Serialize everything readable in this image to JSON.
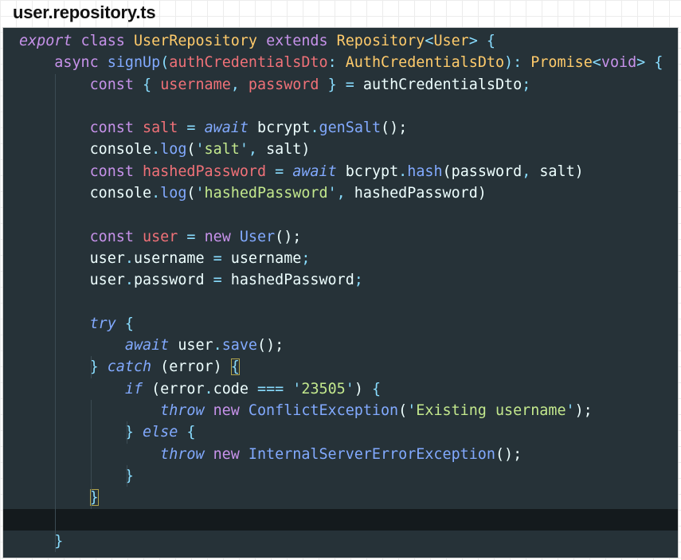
{
  "file_title": "user.repository.ts",
  "colors": {
    "background": "#263238",
    "keyword": "#c792ea",
    "type": "#ffcb6b",
    "function": "#82aaff",
    "parameter": "#f07178",
    "punctuation": "#89ddff",
    "string": "#c3e88d",
    "text": "#eeffff"
  },
  "code": {
    "lines": [
      [
        {
          "t": "export",
          "c": "kwi"
        },
        {
          "t": " ",
          "c": "txt"
        },
        {
          "t": "class",
          "c": "kw"
        },
        {
          "t": " ",
          "c": "txt"
        },
        {
          "t": "UserRepository",
          "c": "cls"
        },
        {
          "t": " ",
          "c": "txt"
        },
        {
          "t": "extends",
          "c": "kw"
        },
        {
          "t": " ",
          "c": "txt"
        },
        {
          "t": "Repository",
          "c": "cls"
        },
        {
          "t": "<",
          "c": "pun"
        },
        {
          "t": "User",
          "c": "cls"
        },
        {
          "t": ">",
          "c": "pun"
        },
        {
          "t": " ",
          "c": "txt"
        },
        {
          "t": "{",
          "c": "pun"
        }
      ],
      [
        {
          "t": "    ",
          "c": "txt"
        },
        {
          "t": "async",
          "c": "kw"
        },
        {
          "t": " ",
          "c": "txt"
        },
        {
          "t": "signUp",
          "c": "fn"
        },
        {
          "t": "(",
          "c": "pun"
        },
        {
          "t": "authCredentialsDto",
          "c": "par"
        },
        {
          "t": ":",
          "c": "pun"
        },
        {
          "t": " ",
          "c": "txt"
        },
        {
          "t": "AuthCredentialsDto",
          "c": "cls"
        },
        {
          "t": ")",
          "c": "pun"
        },
        {
          "t": ":",
          "c": "pun"
        },
        {
          "t": " ",
          "c": "txt"
        },
        {
          "t": "Promise",
          "c": "cls"
        },
        {
          "t": "<",
          "c": "pun"
        },
        {
          "t": "void",
          "c": "kw"
        },
        {
          "t": ">",
          "c": "pun"
        },
        {
          "t": " ",
          "c": "txt"
        },
        {
          "t": "{",
          "c": "pun"
        }
      ],
      [
        {
          "t": "        ",
          "c": "txt"
        },
        {
          "t": "const",
          "c": "kw"
        },
        {
          "t": " ",
          "c": "txt"
        },
        {
          "t": "{",
          "c": "pun"
        },
        {
          "t": " ",
          "c": "txt"
        },
        {
          "t": "username",
          "c": "par"
        },
        {
          "t": ",",
          "c": "pun"
        },
        {
          "t": " ",
          "c": "txt"
        },
        {
          "t": "password",
          "c": "par"
        },
        {
          "t": " ",
          "c": "txt"
        },
        {
          "t": "}",
          "c": "pun"
        },
        {
          "t": " ",
          "c": "txt"
        },
        {
          "t": "=",
          "c": "pun"
        },
        {
          "t": " authCredentialsDto",
          "c": "txt"
        },
        {
          "t": ";",
          "c": "pun"
        }
      ],
      [],
      [
        {
          "t": "        ",
          "c": "txt"
        },
        {
          "t": "const",
          "c": "kw"
        },
        {
          "t": " ",
          "c": "txt"
        },
        {
          "t": "salt",
          "c": "par"
        },
        {
          "t": " ",
          "c": "txt"
        },
        {
          "t": "=",
          "c": "pun"
        },
        {
          "t": " ",
          "c": "txt"
        },
        {
          "t": "await",
          "c": "aw"
        },
        {
          "t": " bcrypt",
          "c": "txt"
        },
        {
          "t": ".",
          "c": "pun"
        },
        {
          "t": "genSalt",
          "c": "fn"
        },
        {
          "t": "();",
          "c": "txt"
        }
      ],
      [
        {
          "t": "        console",
          "c": "txt"
        },
        {
          "t": ".",
          "c": "pun"
        },
        {
          "t": "log",
          "c": "fn"
        },
        {
          "t": "(",
          "c": "txt"
        },
        {
          "t": "'",
          "c": "pun"
        },
        {
          "t": "salt",
          "c": "str"
        },
        {
          "t": "'",
          "c": "pun"
        },
        {
          "t": ",",
          "c": "pun"
        },
        {
          "t": " salt)",
          "c": "txt"
        }
      ],
      [
        {
          "t": "        ",
          "c": "txt"
        },
        {
          "t": "const",
          "c": "kw"
        },
        {
          "t": " ",
          "c": "txt"
        },
        {
          "t": "hashedPassword",
          "c": "par"
        },
        {
          "t": " ",
          "c": "txt"
        },
        {
          "t": "=",
          "c": "pun"
        },
        {
          "t": " ",
          "c": "txt"
        },
        {
          "t": "await",
          "c": "aw"
        },
        {
          "t": " bcrypt",
          "c": "txt"
        },
        {
          "t": ".",
          "c": "pun"
        },
        {
          "t": "hash",
          "c": "fn"
        },
        {
          "t": "(password",
          "c": "txt"
        },
        {
          "t": ",",
          "c": "pun"
        },
        {
          "t": " salt)",
          "c": "txt"
        }
      ],
      [
        {
          "t": "        console",
          "c": "txt"
        },
        {
          "t": ".",
          "c": "pun"
        },
        {
          "t": "log",
          "c": "fn"
        },
        {
          "t": "(",
          "c": "txt"
        },
        {
          "t": "'",
          "c": "pun"
        },
        {
          "t": "hashedPassword",
          "c": "str"
        },
        {
          "t": "'",
          "c": "pun"
        },
        {
          "t": ",",
          "c": "pun"
        },
        {
          "t": " hashedPassword)",
          "c": "txt"
        }
      ],
      [],
      [
        {
          "t": "        ",
          "c": "txt"
        },
        {
          "t": "const",
          "c": "kw"
        },
        {
          "t": " ",
          "c": "txt"
        },
        {
          "t": "user",
          "c": "par"
        },
        {
          "t": " ",
          "c": "txt"
        },
        {
          "t": "=",
          "c": "pun"
        },
        {
          "t": " ",
          "c": "txt"
        },
        {
          "t": "new",
          "c": "kw"
        },
        {
          "t": " ",
          "c": "txt"
        },
        {
          "t": "User",
          "c": "fn"
        },
        {
          "t": "();",
          "c": "txt"
        }
      ],
      [
        {
          "t": "        user",
          "c": "txt"
        },
        {
          "t": ".",
          "c": "pun"
        },
        {
          "t": "username",
          "c": "txt"
        },
        {
          "t": " ",
          "c": "txt"
        },
        {
          "t": "=",
          "c": "pun"
        },
        {
          "t": " username",
          "c": "txt"
        },
        {
          "t": ";",
          "c": "pun"
        }
      ],
      [
        {
          "t": "        user",
          "c": "txt"
        },
        {
          "t": ".",
          "c": "pun"
        },
        {
          "t": "password",
          "c": "txt"
        },
        {
          "t": " ",
          "c": "txt"
        },
        {
          "t": "=",
          "c": "pun"
        },
        {
          "t": " hashedPassword",
          "c": "txt"
        },
        {
          "t": ";",
          "c": "pun"
        }
      ],
      [],
      [
        {
          "t": "        ",
          "c": "txt"
        },
        {
          "t": "try",
          "c": "aw"
        },
        {
          "t": " ",
          "c": "txt"
        },
        {
          "t": "{",
          "c": "pun"
        }
      ],
      [
        {
          "t": "            ",
          "c": "txt"
        },
        {
          "t": "await",
          "c": "aw"
        },
        {
          "t": " user",
          "c": "txt"
        },
        {
          "t": ".",
          "c": "pun"
        },
        {
          "t": "save",
          "c": "fn"
        },
        {
          "t": "();",
          "c": "txt"
        }
      ],
      [
        {
          "t": "        ",
          "c": "txt"
        },
        {
          "t": "}",
          "c": "pun"
        },
        {
          "t": " ",
          "c": "txt"
        },
        {
          "t": "catch",
          "c": "aw"
        },
        {
          "t": " (error) ",
          "c": "txt"
        },
        {
          "t": "{",
          "c": "pun",
          "m": true
        }
      ],
      [
        {
          "t": "            ",
          "c": "txt"
        },
        {
          "t": "if",
          "c": "aw"
        },
        {
          "t": " (error",
          "c": "txt"
        },
        {
          "t": ".",
          "c": "pun"
        },
        {
          "t": "code ",
          "c": "txt"
        },
        {
          "t": "===",
          "c": "pun"
        },
        {
          "t": " ",
          "c": "txt"
        },
        {
          "t": "'",
          "c": "pun"
        },
        {
          "t": "23505",
          "c": "str"
        },
        {
          "t": "'",
          "c": "pun"
        },
        {
          "t": ") ",
          "c": "txt"
        },
        {
          "t": "{",
          "c": "pun"
        }
      ],
      [
        {
          "t": "                ",
          "c": "txt"
        },
        {
          "t": "throw",
          "c": "aw"
        },
        {
          "t": " ",
          "c": "txt"
        },
        {
          "t": "new",
          "c": "kw"
        },
        {
          "t": " ",
          "c": "txt"
        },
        {
          "t": "ConflictException",
          "c": "fn"
        },
        {
          "t": "(",
          "c": "txt"
        },
        {
          "t": "'",
          "c": "pun"
        },
        {
          "t": "Existing username",
          "c": "str"
        },
        {
          "t": "'",
          "c": "pun"
        },
        {
          "t": ");",
          "c": "txt"
        }
      ],
      [
        {
          "t": "            ",
          "c": "txt"
        },
        {
          "t": "}",
          "c": "pun"
        },
        {
          "t": " ",
          "c": "txt"
        },
        {
          "t": "else",
          "c": "aw"
        },
        {
          "t": " ",
          "c": "txt"
        },
        {
          "t": "{",
          "c": "pun"
        }
      ],
      [
        {
          "t": "                ",
          "c": "txt"
        },
        {
          "t": "throw",
          "c": "aw"
        },
        {
          "t": " ",
          "c": "txt"
        },
        {
          "t": "new",
          "c": "kw"
        },
        {
          "t": " ",
          "c": "txt"
        },
        {
          "t": "InternalServerErrorException",
          "c": "fn"
        },
        {
          "t": "();",
          "c": "txt"
        }
      ],
      [
        {
          "t": "            ",
          "c": "txt"
        },
        {
          "t": "}",
          "c": "pun"
        }
      ],
      [
        {
          "t": "        ",
          "c": "txt"
        },
        {
          "t": "}",
          "c": "pun",
          "m": true
        }
      ],
      [],
      [
        {
          "t": "    ",
          "c": "txt"
        },
        {
          "t": "}",
          "c": "pun"
        }
      ]
    ]
  }
}
